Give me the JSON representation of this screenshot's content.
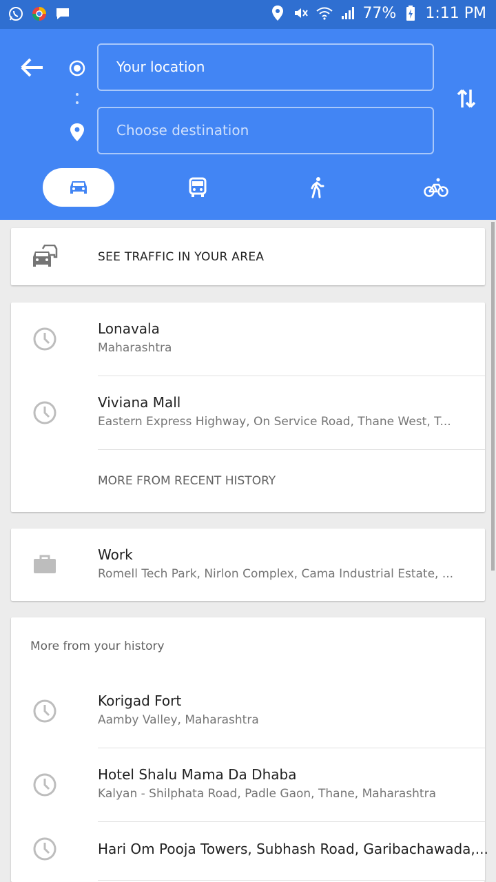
{
  "status_bar": {
    "battery": "77%",
    "time": "1:11 PM"
  },
  "header": {
    "origin_value": "Your location",
    "destination_placeholder": "Choose destination",
    "travel_modes": [
      "car-icon",
      "transit-icon",
      "walk-icon",
      "bike-icon"
    ],
    "active_mode": "car-icon"
  },
  "traffic": {
    "label": "SEE TRAFFIC IN YOUR AREA"
  },
  "recent": {
    "items": [
      {
        "title": "Lonavala",
        "subtitle": "Maharashtra"
      },
      {
        "title": "Viviana Mall",
        "subtitle": "Eastern Express Highway, On Service Road, Thane West, T..."
      }
    ],
    "more_label": "MORE FROM RECENT HISTORY"
  },
  "work": {
    "title": "Work",
    "subtitle": "Romell Tech Park, Nirlon Complex, Cama Industrial Estate, ..."
  },
  "history": {
    "heading": "More from your history",
    "items": [
      {
        "title": "Korigad Fort",
        "subtitle": "Aamby Valley, Maharashtra"
      },
      {
        "title": "Hotel Shalu Mama Da Dhaba",
        "subtitle": "Kalyan - Shilphata Road, Padle Gaon, Thane, Maharashtra"
      },
      {
        "title": "Hari Om Pooja Towers, Subhash Road, Garibachawada,..."
      }
    ]
  },
  "colors": {
    "header_blue": "#4285f4",
    "status_blue": "#2f6fd1",
    "active_mode_icon": "#4285f4",
    "icon_gray": "#9e9e9e"
  }
}
